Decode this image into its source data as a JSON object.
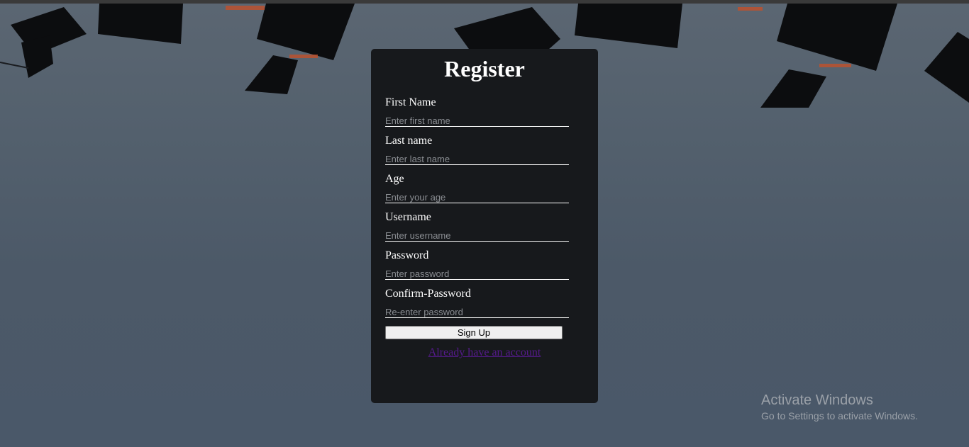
{
  "form": {
    "title": "Register",
    "fields": [
      {
        "label": "First Name",
        "placeholder": "Enter first name"
      },
      {
        "label": "Last name",
        "placeholder": "Enter last name"
      },
      {
        "label": "Age",
        "placeholder": "Enter your age"
      },
      {
        "label": "Username",
        "placeholder": "Enter username"
      },
      {
        "label": "Password",
        "placeholder": "Enter password"
      },
      {
        "label": "Confirm-Password",
        "placeholder": "Re-enter password"
      }
    ],
    "submit_label": "Sign Up",
    "login_link": "Already have an account"
  },
  "watermark": {
    "title": "Activate Windows",
    "subtitle": "Go to Settings to activate Windows."
  },
  "colors": {
    "card_bg": "#17191c",
    "link": "#551a8b",
    "background": "#53606d"
  },
  "background_image": "graduation-caps"
}
